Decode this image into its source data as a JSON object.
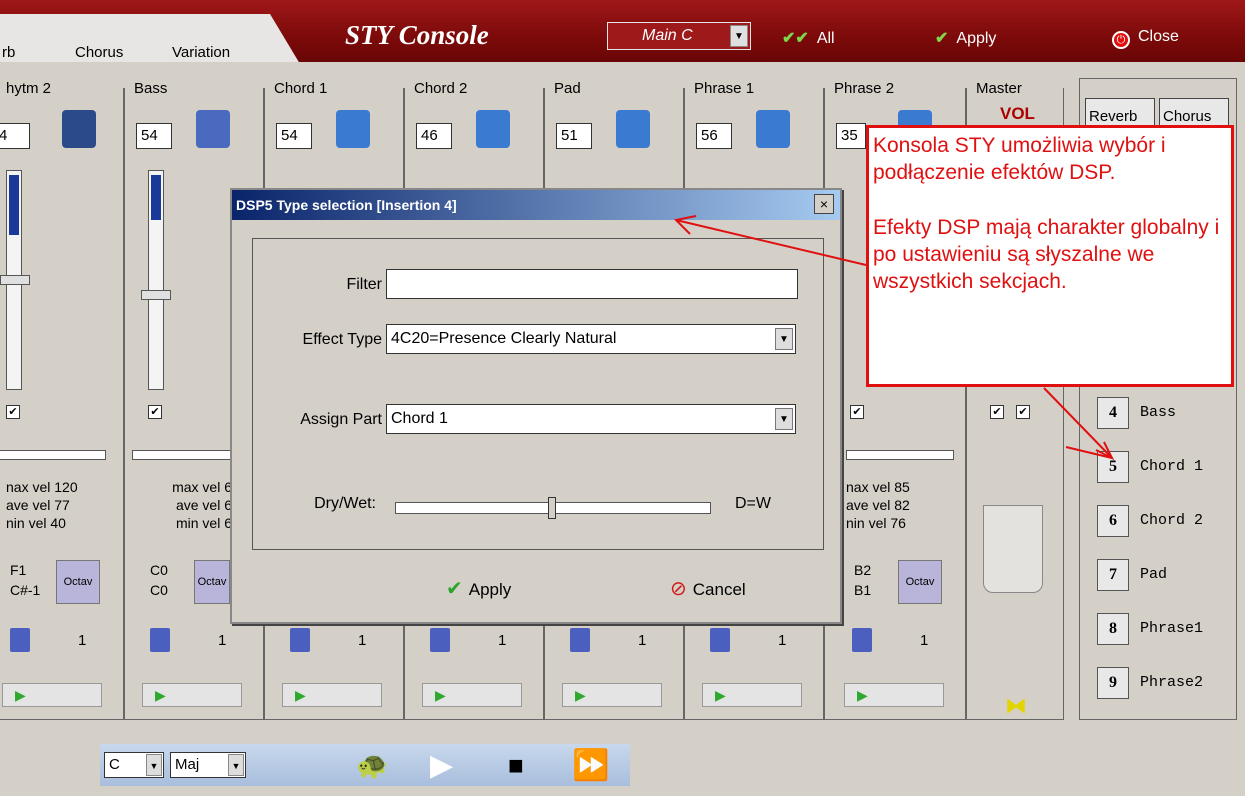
{
  "header": {
    "tabs": [
      "rb",
      "Chorus",
      "Variation"
    ],
    "title": "STY Console",
    "combo_value": "Main C",
    "all_label": "All",
    "apply_label": "Apply",
    "close_label": "Close"
  },
  "channels": [
    {
      "label": "hytm 2",
      "value": "4",
      "max": "120",
      "ave": "77",
      "min": "40",
      "note1": "F1",
      "note2": "C#-1"
    },
    {
      "label": "Bass",
      "value": "54",
      "max": "6",
      "ave": "6",
      "min": "6",
      "note1": "C0",
      "note2": "C0"
    },
    {
      "label": "Chord 1",
      "value": "54"
    },
    {
      "label": "Chord 2",
      "value": "46"
    },
    {
      "label": "Pad",
      "value": "51"
    },
    {
      "label": "Phrase 1",
      "value": "56"
    },
    {
      "label": "Phrase 2",
      "value": "35",
      "max": "85",
      "ave": "82",
      "min": "76",
      "note1": "B2",
      "note2": "B1"
    }
  ],
  "vel_labels": {
    "max": "max vel",
    "ave": "ave vel",
    "min": "min vel",
    "max_cut": "nax vel",
    "min_cut": "nin vel",
    "max_first": "nax vel",
    "min_first": "nin vel"
  },
  "octav_label": "Octav",
  "save_count": "1",
  "master": {
    "label": "Master",
    "vol": "VOL"
  },
  "right_panel": {
    "reverb": "Reverb",
    "chorus": "Chorus",
    "parts": [
      {
        "num": "4",
        "name": "Bass"
      },
      {
        "num": "5",
        "name": "Chord 1"
      },
      {
        "num": "6",
        "name": "Chord 2"
      },
      {
        "num": "7",
        "name": "Pad"
      },
      {
        "num": "8",
        "name": "Phrase1"
      },
      {
        "num": "9",
        "name": "Phrase2"
      }
    ]
  },
  "transport": {
    "key": "C",
    "mode": "Maj"
  },
  "dialog": {
    "title": "DSP5 Type selection [Insertion 4]",
    "close": "×",
    "filter_label": "Filter",
    "filter_value": "",
    "effect_type_label": "Effect Type",
    "effect_type_value": "4C20=Presence Clearly Natural",
    "assign_part_label": "Assign Part",
    "assign_part_value": "Chord 1",
    "drywet_label": "Dry/Wet:",
    "drywet_value": "D=W",
    "drywet_position": 0.5,
    "apply": "Apply",
    "cancel": "Cancel"
  },
  "annotation": {
    "line1": "Konsola STY umożliwia wybór i podłączenie efektów DSP.",
    "line2": "Efekty DSP mają charakter globalny i po ustawieniu są słyszalne we wszystkich sekcjach."
  },
  "colors": {
    "header": "#8a0e0e",
    "annotation": "#e01010",
    "dialog_title": "#0a246a"
  }
}
